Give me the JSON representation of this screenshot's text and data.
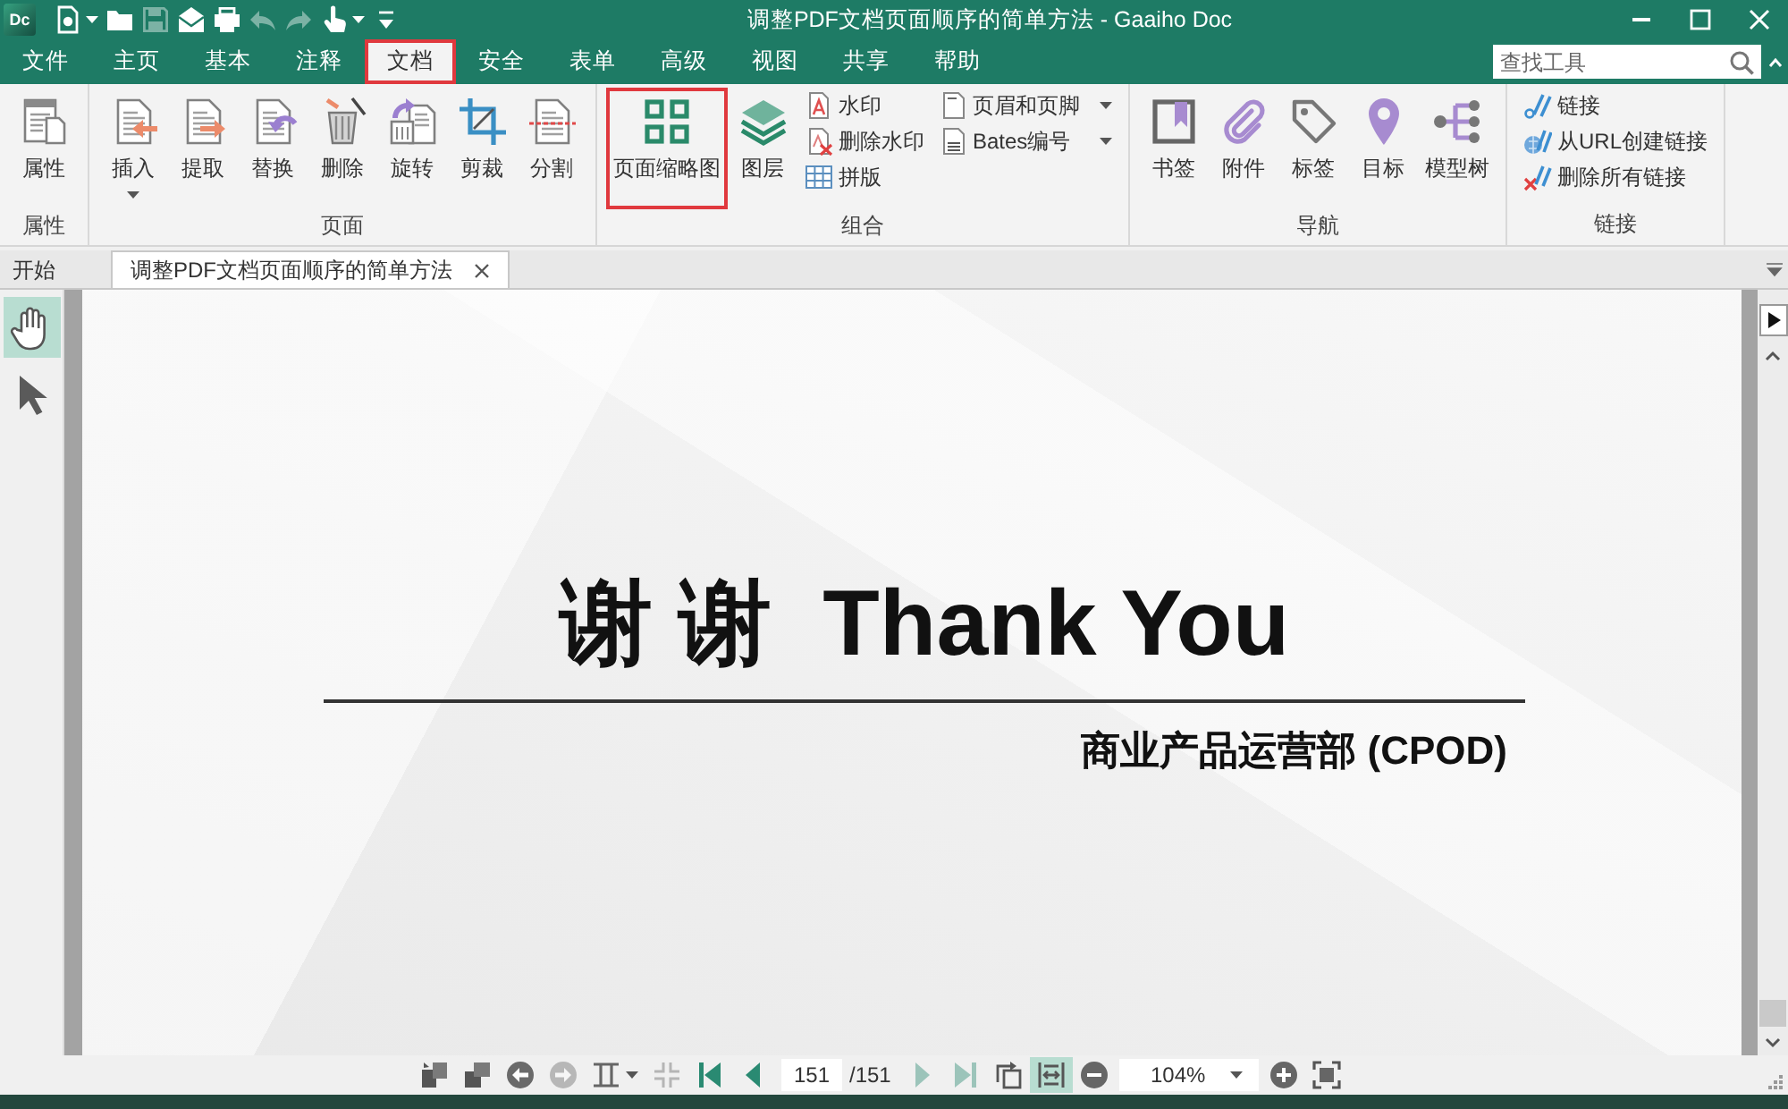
{
  "window": {
    "app_badge": "Dc",
    "title": "调整PDF文档页面顺序的简单方法 - Gaaiho Doc"
  },
  "quick_access": [
    {
      "disabled": false,
      "dropdown": true
    },
    {
      "disabled": false,
      "dropdown": false
    },
    {
      "disabled": true,
      "dropdown": false
    },
    {
      "disabled": false,
      "dropdown": false
    },
    {
      "disabled": false,
      "dropdown": false
    },
    {
      "disabled": true,
      "dropdown": false
    },
    {
      "disabled": true,
      "dropdown": false
    },
    {
      "disabled": false,
      "dropdown": true
    },
    {
      "disabled": false,
      "dropdown": false
    }
  ],
  "menu_tabs": [
    {
      "label": "文件",
      "selected": false,
      "highlighted": false
    },
    {
      "label": "主页",
      "selected": false,
      "highlighted": false
    },
    {
      "label": "基本",
      "selected": false,
      "highlighted": false
    },
    {
      "label": "注释",
      "selected": false,
      "highlighted": false
    },
    {
      "label": "文档",
      "selected": true,
      "highlighted": true
    },
    {
      "label": "安全",
      "selected": false,
      "highlighted": false
    },
    {
      "label": "表单",
      "selected": false,
      "highlighted": false
    },
    {
      "label": "高级",
      "selected": false,
      "highlighted": false
    },
    {
      "label": "视图",
      "selected": false,
      "highlighted": false
    },
    {
      "label": "共享",
      "selected": false,
      "highlighted": false
    },
    {
      "label": "帮助",
      "selected": false,
      "highlighted": false
    }
  ],
  "search": {
    "placeholder": "查找工具"
  },
  "ribbon": [
    {
      "label": "属性",
      "items": [
        {
          "kind": "large",
          "label": "属性",
          "dropdown": false,
          "highlighted": false
        }
      ]
    },
    {
      "label": "页面",
      "items": [
        {
          "kind": "large",
          "label": "插入",
          "dropdown": true,
          "highlighted": false
        },
        {
          "kind": "large",
          "label": "提取",
          "dropdown": false,
          "highlighted": false
        },
        {
          "kind": "large",
          "label": "替换",
          "dropdown": false,
          "highlighted": false
        },
        {
          "kind": "large",
          "label": "删除",
          "dropdown": false,
          "highlighted": false
        },
        {
          "kind": "large",
          "label": "旋转",
          "dropdown": false,
          "highlighted": false
        },
        {
          "kind": "large",
          "label": "剪裁",
          "dropdown": false,
          "highlighted": false
        },
        {
          "kind": "large",
          "label": "分割",
          "dropdown": false,
          "highlighted": false
        }
      ]
    },
    {
      "label": "组合",
      "items": [
        {
          "kind": "large",
          "label": "页面缩略图",
          "dropdown": false,
          "highlighted": true
        },
        {
          "kind": "large",
          "label": "图层",
          "dropdown": false,
          "highlighted": false
        },
        {
          "kind": "small",
          "label": "水印",
          "dropdown": false,
          "highlighted": false
        },
        {
          "kind": "small",
          "label": "删除水印",
          "dropdown": false,
          "highlighted": false
        },
        {
          "kind": "small",
          "label": "拼版",
          "dropdown": false,
          "highlighted": false
        },
        {
          "kind": "small",
          "label": "页眉和页脚",
          "dropdown": true,
          "highlighted": false
        },
        {
          "kind": "small",
          "label": "Bates编号",
          "dropdown": true,
          "highlighted": false
        }
      ]
    },
    {
      "label": "导航",
      "items": [
        {
          "kind": "large",
          "label": "书签",
          "dropdown": false,
          "highlighted": false
        },
        {
          "kind": "large",
          "label": "附件",
          "dropdown": false,
          "highlighted": false
        },
        {
          "kind": "large",
          "label": "标签",
          "dropdown": false,
          "highlighted": false
        },
        {
          "kind": "large",
          "label": "目标",
          "dropdown": false,
          "highlighted": false
        },
        {
          "kind": "large",
          "label": "模型树",
          "dropdown": false,
          "highlighted": false
        }
      ]
    },
    {
      "label": "链接",
      "items": [
        {
          "kind": "small",
          "label": "链接",
          "dropdown": false,
          "highlighted": false
        },
        {
          "kind": "small",
          "label": "从URL创建链接",
          "dropdown": false,
          "highlighted": false
        },
        {
          "kind": "small",
          "label": "删除所有链接",
          "dropdown": false,
          "highlighted": false
        }
      ]
    }
  ],
  "doc_tabs": [
    {
      "label": "开始",
      "selected": false,
      "closable": false
    },
    {
      "label": "调整PDF文档页面顺序的简单方法",
      "selected": true,
      "closable": true
    }
  ],
  "tools": [
    {
      "selected": true
    },
    {
      "selected": false
    }
  ],
  "page": {
    "heading": "谢 谢  Thank You",
    "subtitle": "商业产品运营部 (CPOD)"
  },
  "status_bar": {
    "items": [
      {
        "kind": "button",
        "disabled": false,
        "selected": false,
        "dropdown": false
      },
      {
        "kind": "button",
        "disabled": false,
        "selected": false,
        "dropdown": false
      },
      {
        "kind": "button",
        "disabled": false,
        "selected": false,
        "dropdown": false
      },
      {
        "kind": "button",
        "disabled": true,
        "selected": false,
        "dropdown": false
      },
      {
        "kind": "button",
        "disabled": false,
        "selected": false,
        "dropdown": true
      },
      {
        "kind": "button",
        "disabled": true,
        "selected": false,
        "dropdown": false
      },
      {
        "kind": "button",
        "disabled": false,
        "selected": false,
        "dropdown": false
      },
      {
        "kind": "button",
        "disabled": false,
        "selected": false,
        "dropdown": false
      },
      {
        "kind": "page_field",
        "value": "151",
        "total": "/151"
      },
      {
        "kind": "button",
        "disabled": true,
        "selected": false,
        "dropdown": false
      },
      {
        "kind": "button",
        "disabled": true,
        "selected": false,
        "dropdown": false
      },
      {
        "kind": "button",
        "disabled": false,
        "selected": false,
        "dropdown": false
      },
      {
        "kind": "button",
        "disabled": false,
        "selected": true,
        "dropdown": false
      },
      {
        "kind": "button",
        "disabled": false,
        "selected": false,
        "dropdown": false
      },
      {
        "kind": "zoom_field",
        "value": "104%"
      },
      {
        "kind": "button",
        "disabled": false,
        "selected": false,
        "dropdown": false
      },
      {
        "kind": "button",
        "disabled": false,
        "selected": false,
        "dropdown": false
      }
    ]
  }
}
